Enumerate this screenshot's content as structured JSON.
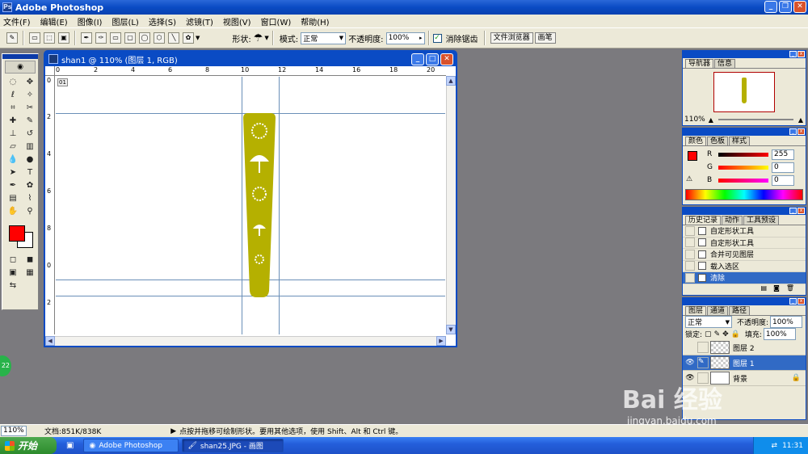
{
  "app": {
    "title": "Adobe Photoshop"
  },
  "menu": [
    "文件(F)",
    "编辑(E)",
    "图像(I)",
    "图层(L)",
    "选择(S)",
    "滤镜(T)",
    "视图(V)",
    "窗口(W)",
    "帮助(H)"
  ],
  "options": {
    "shape_label": "形状:",
    "mode_label": "模式:",
    "mode_value": "正常",
    "opacity_label": "不透明度:",
    "opacity_value": "100%",
    "antialias_label": "消除锯齿",
    "tab_file_browser": "文件浏览器",
    "tab_brushes": "画笔"
  },
  "document": {
    "title": "shan1 @ 110% (图层 1, RGB)",
    "ruler_top": [
      "0",
      "2",
      "4",
      "6",
      "8",
      "10",
      "12",
      "14",
      "16",
      "18",
      "20"
    ],
    "ruler_left": [
      "0",
      "2",
      "4",
      "6",
      "8",
      "0",
      "2"
    ],
    "ruler_unit_badge": "01"
  },
  "panels": {
    "navigator": {
      "tabs": [
        "导航器",
        "信息"
      ],
      "zoom": "110%"
    },
    "color": {
      "tabs": [
        "颜色",
        "色板",
        "样式"
      ],
      "r_label": "R",
      "g_label": "G",
      "b_label": "B",
      "r_value": "255",
      "g_value": "0",
      "b_value": "0",
      "fg_color": "#ff0000"
    },
    "history": {
      "tabs": [
        "历史记录",
        "动作",
        "工具预设"
      ],
      "items": [
        "自定形状工具",
        "自定形状工具",
        "合并可见图层",
        "载入选区",
        "清除"
      ]
    },
    "layers": {
      "tabs": [
        "图层",
        "通道",
        "路径"
      ],
      "blend_mode": "正常",
      "opacity_label": "不透明度:",
      "opacity_value": "100%",
      "lock_label": "锁定:",
      "fill_label": "填充:",
      "fill_value": "100%",
      "items": [
        "图层 2",
        "图层 1",
        "背景"
      ]
    }
  },
  "status": {
    "zoom": "110%",
    "doc_info": "文档:851K/838K",
    "hint": "点按并拖移可绘制形状。要用其他选项，使用 Shift、Alt 和 Ctrl 键。"
  },
  "taskbar": {
    "start_label": "开始",
    "tasks": [
      "Adobe Photoshop",
      "shan25.JPG - 画图"
    ],
    "clock": "11:31"
  },
  "watermark": {
    "logo": "Bai 经验",
    "url": "jingyan.baidu.com"
  },
  "colors": {
    "shape_fill": "#b5b000",
    "title_blue": "#0a4bc4",
    "guide": "#6a8fb8"
  }
}
